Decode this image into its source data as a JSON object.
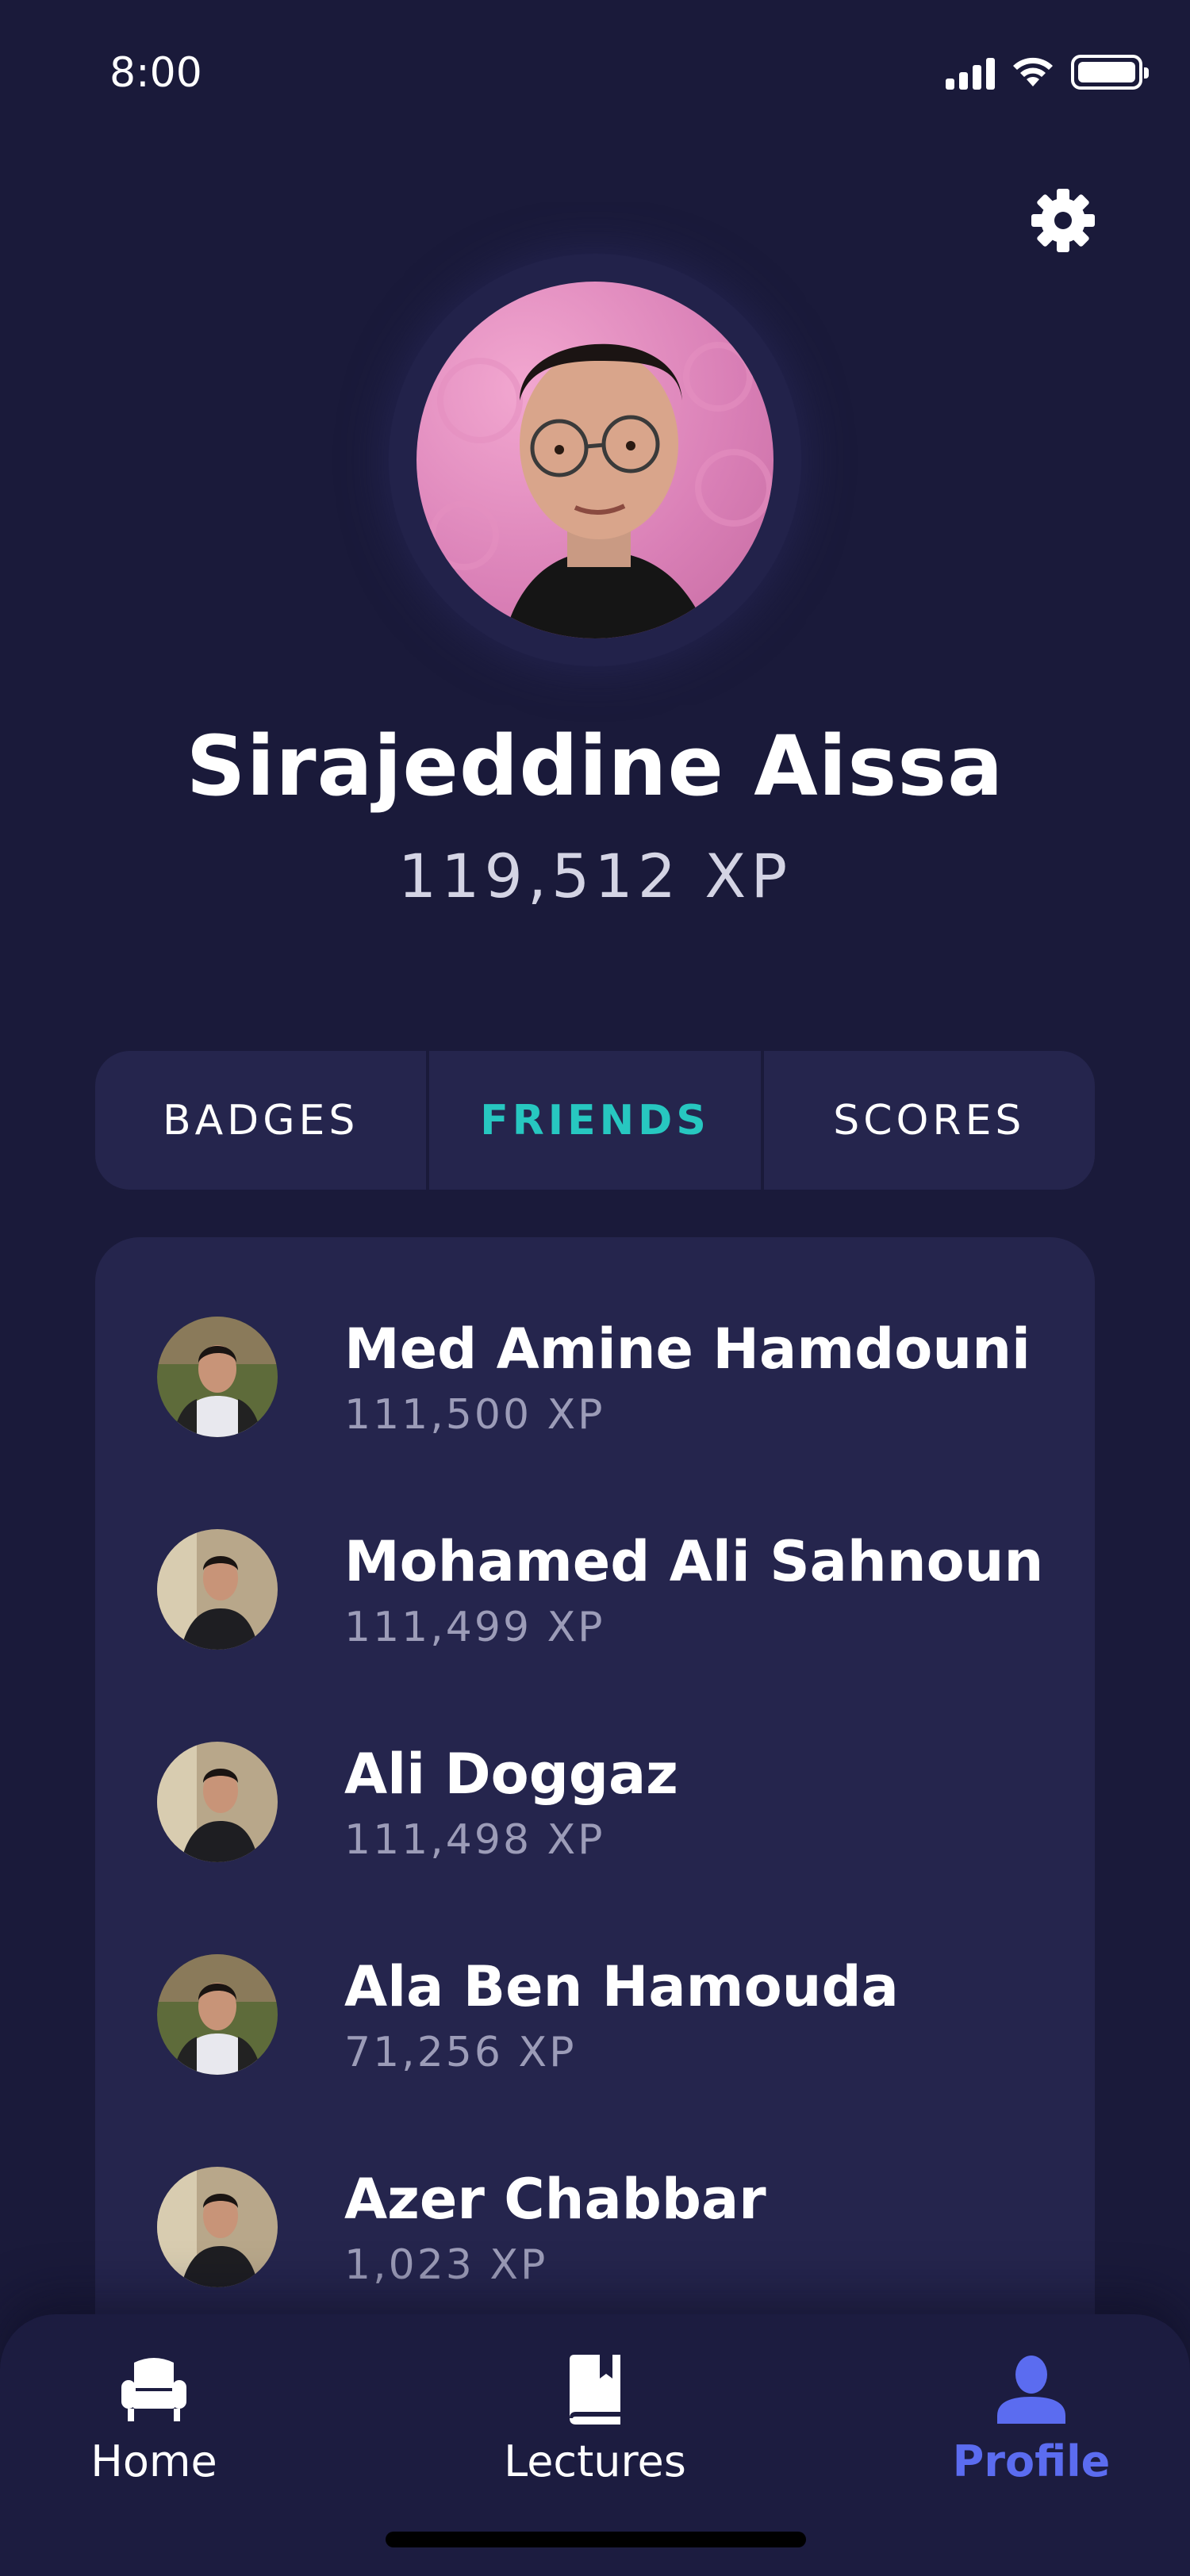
{
  "status_bar": {
    "time": "8:00"
  },
  "profile": {
    "name": "Sirajeddine Aissa",
    "xp": "119,512 XP"
  },
  "tabs": [
    {
      "label": "BADGES",
      "active": false
    },
    {
      "label": "FRIENDS",
      "active": true
    },
    {
      "label": "SCORES",
      "active": false
    }
  ],
  "friends": [
    {
      "name": "Med Amine Hamdouni",
      "xp": "111,500 XP"
    },
    {
      "name": "Mohamed Ali Sahnoun",
      "xp": "111,499 XP"
    },
    {
      "name": "Ali Doggaz",
      "xp": "111,498 XP"
    },
    {
      "name": "Ala Ben Hamouda",
      "xp": "71,256 XP"
    },
    {
      "name": "Azer Chabbar",
      "xp": "1,023 XP"
    }
  ],
  "bottom_nav": [
    {
      "label": "Home",
      "icon": "armchair-icon",
      "active": false
    },
    {
      "label": "Lectures",
      "icon": "book-icon",
      "active": false
    },
    {
      "label": "Profile",
      "icon": "user-icon",
      "active": true
    }
  ],
  "colors": {
    "background": "#1a1a3a",
    "card": "#25254d",
    "accent_tab": "#27c7c0",
    "accent_nav": "#5b6cf0"
  }
}
